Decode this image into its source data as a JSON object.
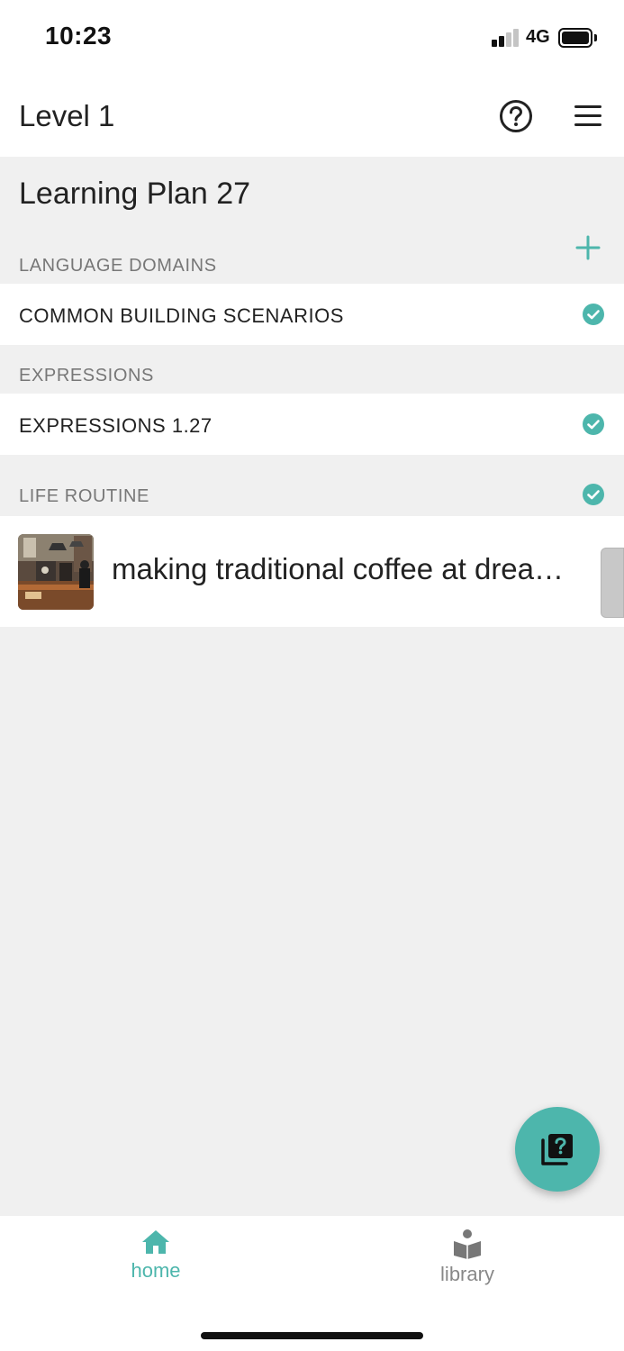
{
  "status_bar": {
    "time": "10:23",
    "network": "4G",
    "signal_bars_active": 2,
    "signal_bars_total": 4,
    "battery_level": 0.9
  },
  "header": {
    "title": "Level 1",
    "help_icon": "question-circle-icon",
    "menu_icon": "hamburger-menu-icon"
  },
  "plan": {
    "title": "Learning Plan 27",
    "add_icon": "plus-icon"
  },
  "sections": [
    {
      "label": "LANGUAGE DOMAINS",
      "item": "COMMON BUILDING SCENARIOS",
      "completed": true
    },
    {
      "label": "EXPRESSIONS",
      "item": "EXPRESSIONS 1.27",
      "completed": true
    },
    {
      "label": "LIFE ROUTINE",
      "completed": true
    }
  ],
  "story": {
    "title": "making traditional coffee at drea…",
    "thumbnail_icon": "coffee-shop-photo"
  },
  "fab": {
    "icon": "quiz-icon"
  },
  "bottom_nav": [
    {
      "label": "home",
      "icon": "home-icon",
      "active": true
    },
    {
      "label": "library",
      "icon": "book-reader-icon",
      "active": false
    }
  ],
  "colors": {
    "accent": "#4db6ac",
    "check": "#4db6ac",
    "background": "#f0f0f0",
    "inactive": "#888888"
  }
}
